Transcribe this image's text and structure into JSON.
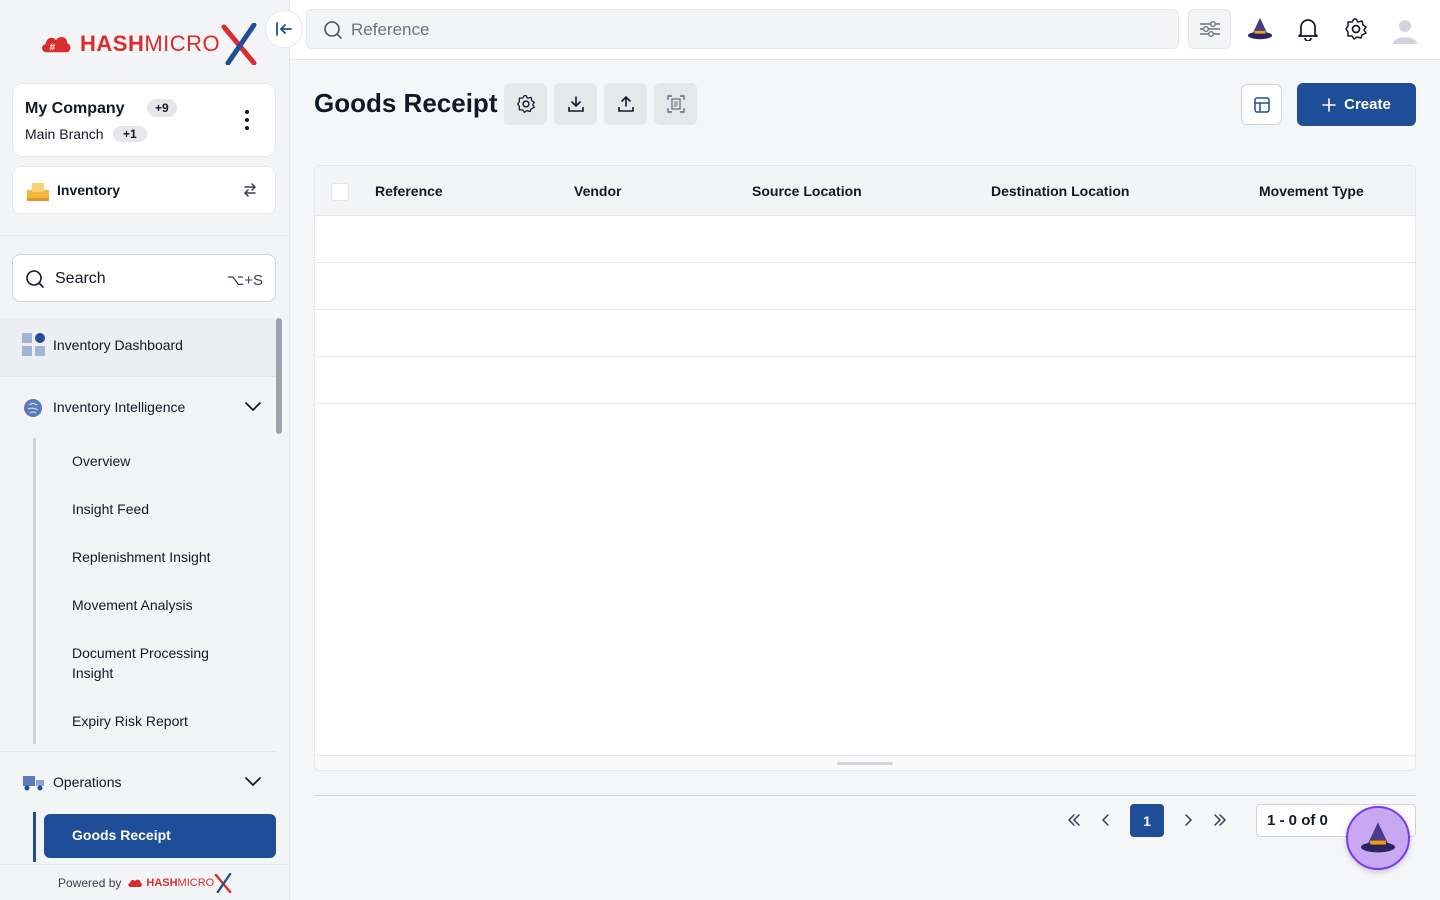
{
  "brand": {
    "logo_word_bold": "HASH",
    "logo_word_light": "MICRO",
    "logo_x": "X",
    "colors": {
      "primary": "#1f4e99",
      "brand_red": "#d92d2d"
    }
  },
  "sidebar": {
    "company": {
      "name": "My Company",
      "badge": "+9",
      "branch": "Main Branch",
      "branch_badge": "+1"
    },
    "module": {
      "label": "Inventory"
    },
    "search": {
      "label": "Search",
      "shortcut": "⌥+S"
    },
    "items": [
      {
        "label": "Inventory Dashboard"
      },
      {
        "label": "Inventory Intelligence",
        "expanded": true,
        "children": [
          {
            "label": "Overview"
          },
          {
            "label": "Insight Feed"
          },
          {
            "label": "Replenishment Insight"
          },
          {
            "label": "Movement Analysis"
          },
          {
            "label": "Document Processing Insight"
          },
          {
            "label": "Expiry Risk Report"
          }
        ]
      },
      {
        "label": "Operations",
        "expanded": true,
        "children": [
          {
            "label": "Goods Receipt",
            "active": true
          }
        ]
      }
    ],
    "powered_by": "Powered by"
  },
  "topbar": {
    "search_placeholder": "Reference"
  },
  "page": {
    "title": "Goods Receipt",
    "create_label": "Create"
  },
  "table": {
    "columns": [
      "Reference",
      "Vendor",
      "Source Location",
      "Destination Location",
      "Movement Type"
    ],
    "rows": []
  },
  "pagination": {
    "current_page": "1",
    "range": "1 - 0",
    "of_label": "of",
    "total": "0"
  }
}
